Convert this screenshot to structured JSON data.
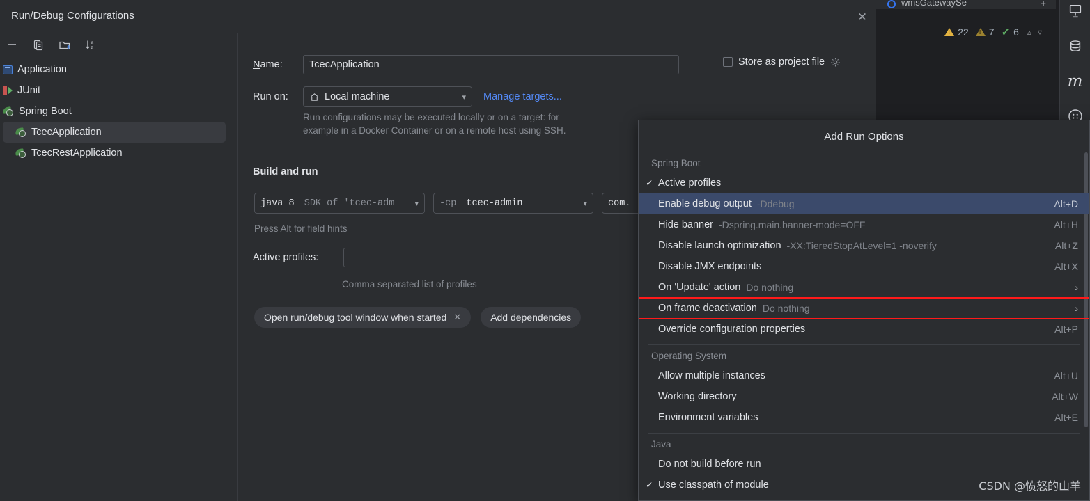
{
  "dialog": {
    "title": "Run/Debug Configurations",
    "close_icon": "close-icon"
  },
  "left_panel": {
    "toolbar": [
      {
        "name": "remove-configuration-button",
        "glyph": "—"
      },
      {
        "name": "copy-configuration-button",
        "glyph": "copy-icon"
      },
      {
        "name": "new-folder-button",
        "glyph": "folder-plus-icon"
      },
      {
        "name": "sort-configurations-button",
        "glyph": "sort-az-icon"
      }
    ],
    "tree": [
      {
        "label": "Application",
        "icon": "application-icon",
        "level": 0,
        "selected": false
      },
      {
        "label": "JUnit",
        "icon": "junit-icon",
        "level": 0,
        "selected": false
      },
      {
        "label": "Spring Boot",
        "icon": "spring-boot-icon",
        "level": 0,
        "selected": false
      },
      {
        "label": "TcecApplication",
        "icon": "spring-boot-icon",
        "level": 1,
        "selected": true
      },
      {
        "label": "TcecRestApplication",
        "icon": "spring-boot-icon",
        "level": 1,
        "selected": false
      }
    ]
  },
  "form": {
    "name_label": "Name:",
    "name_value": "TcecApplication",
    "store_as_project_file_label": "Store as project file",
    "store_as_project_file_checked": false,
    "run_on_label": "Run on:",
    "run_on_value": "Local machine",
    "manage_targets_link": "Manage targets...",
    "run_on_hint_line1": "Run configurations may be executed locally or on a target: for",
    "run_on_hint_line2": "example in a Docker Container or on a remote host using SSH.",
    "build_and_run_title": "Build and run",
    "jre_prefix": "java 8",
    "jre_suffix": "SDK of 'tcec-adm",
    "cp_prefix": "-cp",
    "cp_suffix": "tcec-admin",
    "main_class_value": "com.",
    "field_hints": "Press Alt for field hints",
    "active_profiles_label": "Active profiles:",
    "active_profiles_value": "",
    "active_profiles_hint": "Comma separated list of profiles",
    "chips": [
      {
        "label": "Open run/debug tool window when started",
        "removable": true
      },
      {
        "label": "Add dependencies",
        "removable": false
      }
    ]
  },
  "popup": {
    "title": "Add Run Options",
    "groups": [
      {
        "label": "Spring Boot",
        "items": [
          {
            "label": "Active profiles",
            "sub": "",
            "accel": "",
            "checked": true,
            "submenu": false,
            "highlighted": false,
            "boxed": false
          },
          {
            "label": "Enable debug output",
            "sub": "-Ddebug",
            "accel": "Alt+D",
            "checked": false,
            "submenu": false,
            "highlighted": true,
            "boxed": false
          },
          {
            "label": "Hide banner",
            "sub": "-Dspring.main.banner-mode=OFF",
            "accel": "Alt+H",
            "checked": false,
            "submenu": false,
            "highlighted": false,
            "boxed": false
          },
          {
            "label": "Disable launch optimization",
            "sub": "-XX:TieredStopAtLevel=1 -noverify",
            "accel": "Alt+Z",
            "checked": false,
            "submenu": false,
            "highlighted": false,
            "boxed": false
          },
          {
            "label": "Disable JMX endpoints",
            "sub": "",
            "accel": "Alt+X",
            "checked": false,
            "submenu": false,
            "highlighted": false,
            "boxed": false
          },
          {
            "label": "On 'Update' action",
            "sub": "Do nothing",
            "accel": "",
            "checked": false,
            "submenu": true,
            "highlighted": false,
            "boxed": false
          },
          {
            "label": "On frame deactivation",
            "sub": "Do nothing",
            "accel": "",
            "checked": false,
            "submenu": true,
            "highlighted": false,
            "boxed": true
          },
          {
            "label": "Override configuration properties",
            "sub": "",
            "accel": "Alt+P",
            "checked": false,
            "submenu": false,
            "highlighted": false,
            "boxed": false
          }
        ]
      },
      {
        "label": "Operating System",
        "items": [
          {
            "label": "Allow multiple instances",
            "sub": "",
            "accel": "Alt+U",
            "checked": false,
            "submenu": false,
            "highlighted": false,
            "boxed": false
          },
          {
            "label": "Working directory",
            "sub": "",
            "accel": "Alt+W",
            "checked": false,
            "submenu": false,
            "highlighted": false,
            "boxed": false
          },
          {
            "label": "Environment variables",
            "sub": "",
            "accel": "Alt+E",
            "checked": false,
            "submenu": false,
            "highlighted": false,
            "boxed": false
          }
        ]
      },
      {
        "label": "Java",
        "items": [
          {
            "label": "Do not build before run",
            "sub": "",
            "accel": "",
            "checked": false,
            "submenu": false,
            "highlighted": false,
            "boxed": false
          },
          {
            "label": "Use classpath of module",
            "sub": "",
            "accel": "",
            "checked": true,
            "submenu": false,
            "highlighted": false,
            "boxed": false
          }
        ]
      }
    ]
  },
  "ide": {
    "tab_label": "wmsGatewaySe",
    "inspections": {
      "warnings_major": "22",
      "warnings_minor": "7",
      "checks": "6"
    },
    "right_toolbar": [
      {
        "name": "deploy-icon"
      },
      {
        "name": "database-icon"
      },
      {
        "name": "maven-icon"
      },
      {
        "name": "more-tool-windows-icon"
      }
    ],
    "stripes": [
      "#c9a227",
      "#c9a227",
      "#4f7d6e",
      "#c9a227",
      "#c9a227",
      "#c9a227",
      "#c9a227"
    ]
  },
  "watermark": "CSDN @愤怒的山羊",
  "colors": {
    "accent_blue": "#548af7",
    "selection": "#3b4a6b",
    "highlight_box": "#ff1a1a",
    "bg": "#2b2d30"
  }
}
